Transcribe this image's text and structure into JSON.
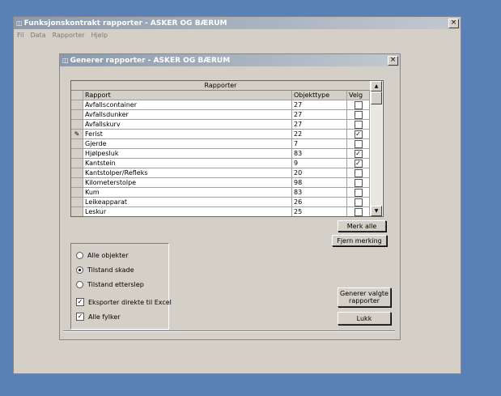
{
  "main_window": {
    "title": "Funksjonskontrakt rapporter - ASKER OG BÆRUM",
    "close_glyph": "×",
    "menu": [
      {
        "label": "Fil"
      },
      {
        "label": "Data"
      },
      {
        "label": "Rapporter"
      },
      {
        "label": "Hjelp"
      }
    ]
  },
  "dialog": {
    "title": "Generer rapporter - ASKER OG BÆRUM",
    "close_glyph": "×",
    "grid": {
      "caption": "Rapporter",
      "headers": {
        "rapport": "Rapport",
        "objekttype": "Objekttype",
        "velg": "Velg"
      },
      "rows": [
        {
          "rapport": "Avfallscontainer",
          "objekttype": "27",
          "checked": false,
          "mark": ""
        },
        {
          "rapport": "Avfallsdunker",
          "objekttype": "27",
          "checked": false,
          "mark": ""
        },
        {
          "rapport": "Avfallskurv",
          "objekttype": "27",
          "checked": false,
          "mark": ""
        },
        {
          "rapport": "Ferist",
          "objekttype": "22",
          "checked": true,
          "mark": "✎"
        },
        {
          "rapport": "Gjerde",
          "objekttype": "7",
          "checked": false,
          "mark": ""
        },
        {
          "rapport": "Hjølpesluk",
          "objekttype": "83",
          "checked": true,
          "mark": ""
        },
        {
          "rapport": "Kantstein",
          "objekttype": "9",
          "checked": true,
          "mark": ""
        },
        {
          "rapport": "Kantstolper/Refleks",
          "objekttype": "20",
          "checked": false,
          "mark": ""
        },
        {
          "rapport": "Kilometerstolpe",
          "objekttype": "98",
          "checked": false,
          "mark": ""
        },
        {
          "rapport": "Kum",
          "objekttype": "83",
          "checked": false,
          "mark": ""
        },
        {
          "rapport": "Leikeapparat",
          "objekttype": "26",
          "checked": false,
          "mark": ""
        },
        {
          "rapport": "Leskur",
          "objekttype": "25",
          "checked": false,
          "mark": ""
        }
      ],
      "scroll_up": "▲",
      "scroll_down": "▼"
    },
    "buttons": {
      "merk_alle": "Merk alle",
      "fjern_merking": "Fjern merking",
      "generer": "Generer valgte rapporter",
      "lukk": "Lukk"
    },
    "options": {
      "radios": [
        {
          "label": "Alle objekter",
          "selected": false
        },
        {
          "label": "Tilstand skade",
          "selected": true
        },
        {
          "label": "Tilstand etterslep",
          "selected": false
        }
      ],
      "checkboxes": [
        {
          "label": "Eksporter direkte til Excel",
          "checked": true
        },
        {
          "label": "Alle fylker",
          "checked": true
        }
      ]
    }
  }
}
